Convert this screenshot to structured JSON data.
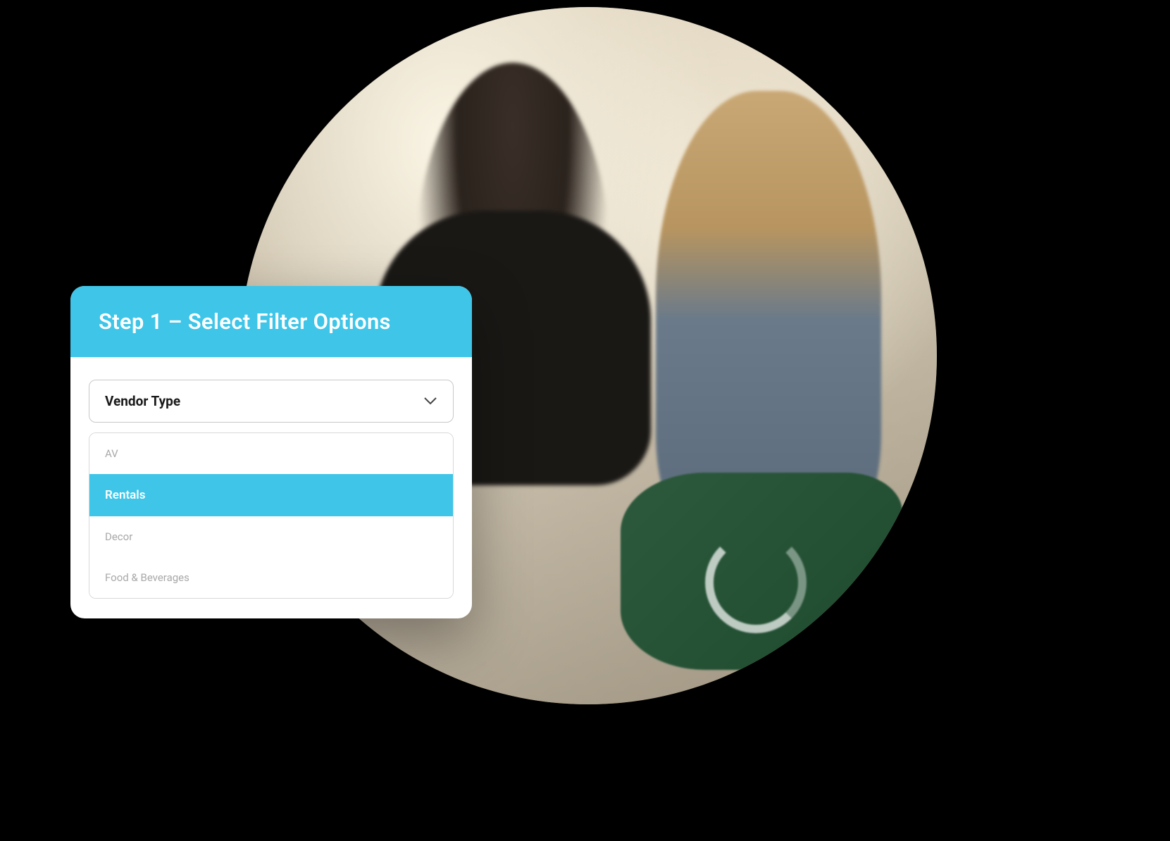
{
  "card": {
    "title": "Step 1 – Select Filter Options"
  },
  "select": {
    "label": "Vendor Type",
    "options": [
      {
        "label": "AV",
        "selected": false
      },
      {
        "label": "Rentals",
        "selected": true
      },
      {
        "label": "Decor",
        "selected": false
      },
      {
        "label": "Food & Beverages",
        "selected": false
      }
    ]
  },
  "colors": {
    "accent": "#3ec5e8"
  }
}
